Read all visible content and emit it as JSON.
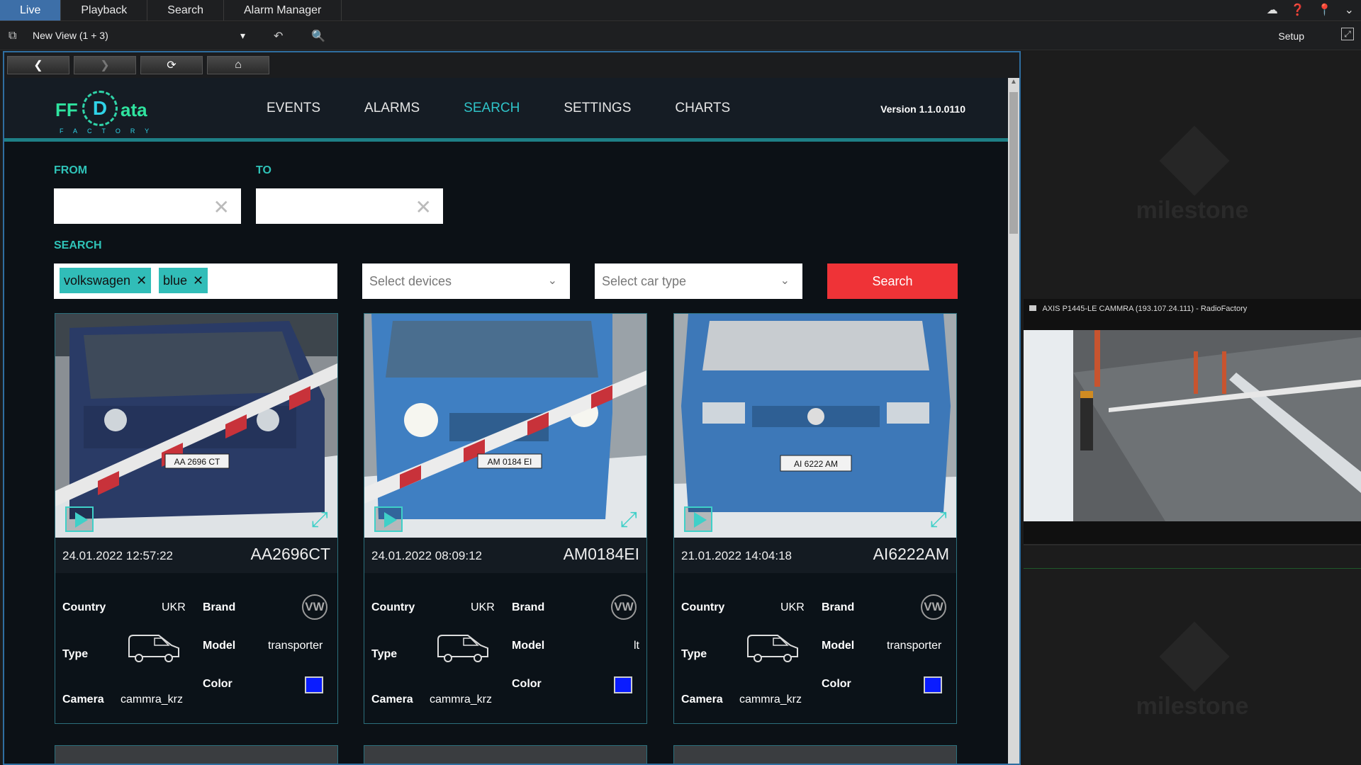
{
  "top_tabs": [
    "Live",
    "Playback",
    "Search",
    "Alarm Manager"
  ],
  "view": {
    "name": "New View (1 + 3)",
    "setup_label": "Setup"
  },
  "app": {
    "logo": {
      "ff": "FF",
      "d": "D",
      "ata": "ata",
      "factory": "FACTORY"
    },
    "menu": [
      "EVENTS",
      "ALARMS",
      "SEARCH",
      "SETTINGS",
      "CHARTS"
    ],
    "active_menu": "SEARCH",
    "version": "Version 1.1.0.0110",
    "filters": {
      "from_label": "FROM",
      "to_label": "TO",
      "from_value": "",
      "to_value": "",
      "search_label": "SEARCH",
      "tags": [
        "volkswagen",
        "blue"
      ],
      "devices_placeholder": "Select devices",
      "car_type_placeholder": "Select car type",
      "search_button": "Search"
    },
    "field_labels": {
      "country": "Country",
      "brand": "Brand",
      "type": "Type",
      "model": "Model",
      "color": "Color",
      "camera": "Camera"
    },
    "results": [
      {
        "timestamp": "24.01.2022 12:57:22",
        "plate": "AA2696CT",
        "photo_plate": "AA 2696 CT",
        "country": "UKR",
        "brand": "VW",
        "model": "transporter",
        "color": "#0a1cff",
        "camera": "cammra_krz"
      },
      {
        "timestamp": "24.01.2022 08:09:12",
        "plate": "AM0184EI",
        "photo_plate": "AM 0184 EI",
        "country": "UKR",
        "brand": "VW",
        "model": "lt",
        "color": "#0a1cff",
        "camera": "cammra_krz"
      },
      {
        "timestamp": "21.01.2022 14:04:18",
        "plate": "AI6222AM",
        "photo_plate": "AI 6222 AM",
        "country": "UKR",
        "brand": "VW",
        "model": "transporter",
        "color": "#0a1cff",
        "camera": "cammra_krz"
      }
    ]
  },
  "right_panel": {
    "camera_title": "AXIS P1445-LE CAMMRA (193.107.24.111) - RadioFactory",
    "watermark": "milestone"
  },
  "colors": {
    "accent": "#2fc3b8",
    "search_button": "#ef3337",
    "active_tab": "#3d6fa8"
  }
}
